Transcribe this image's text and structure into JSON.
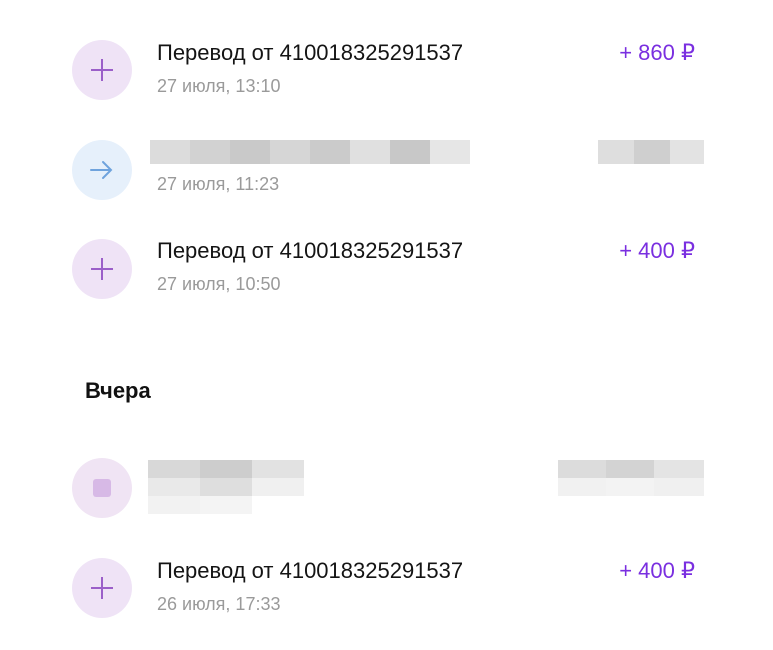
{
  "transactions_today": [
    {
      "title": "Перевод от 410018325291537",
      "date": "27 июля, 13:10",
      "amount": "+ 860 ₽",
      "icon": "plus-icon"
    },
    {
      "title": "",
      "date": "27 июля, 11:23",
      "amount": "",
      "icon": "arrow-right-icon"
    },
    {
      "title": "Перевод от 410018325291537",
      "date": "27 июля, 10:50",
      "amount": "+ 400 ₽",
      "icon": "plus-icon"
    }
  ],
  "yesterday": {
    "header": "Вчера",
    "transactions": [
      {
        "title": "",
        "date": "",
        "amount": "",
        "icon": "avatar-icon"
      },
      {
        "title": "Перевод от 410018325291537",
        "date": "26 июля, 17:33",
        "amount": "+ 400 ₽",
        "icon": "plus-icon"
      }
    ]
  },
  "colors": {
    "accent": "#7a2fe0",
    "icon_purple_bg": "#efe3f6",
    "icon_blue_bg": "#e6f0fb",
    "date_grey": "#9a9a9a"
  }
}
